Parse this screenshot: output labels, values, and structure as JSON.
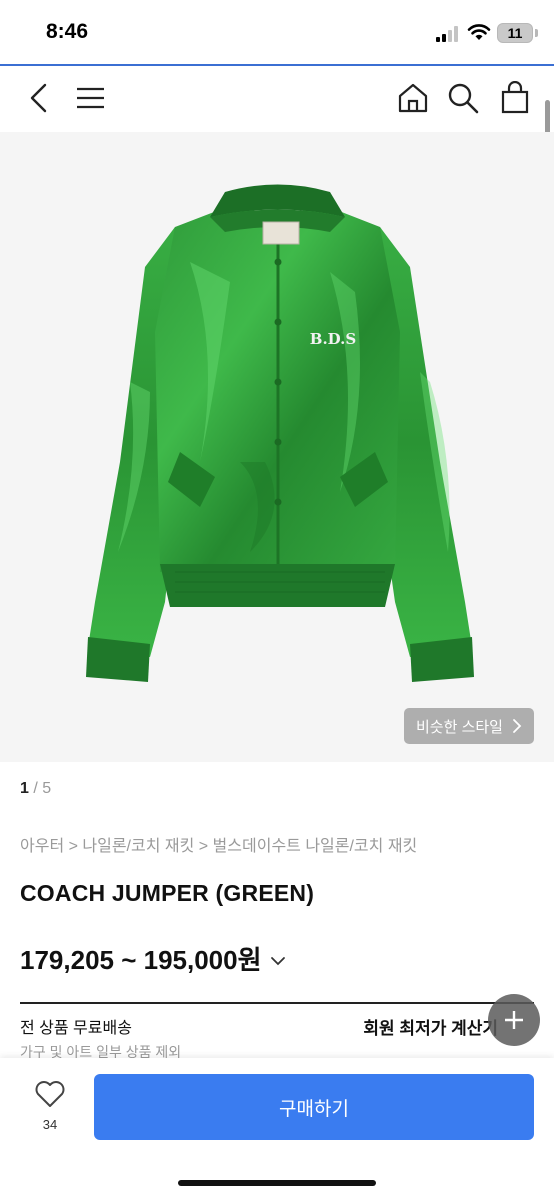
{
  "status_bar": {
    "time": "8:46",
    "battery_level": "11"
  },
  "header": {
    "back_icon": "chevron-left-icon",
    "menu_icon": "hamburger-menu-icon",
    "home_icon": "home-icon",
    "search_icon": "search-icon",
    "cart_icon": "shopping-bag-icon"
  },
  "product": {
    "image_alt": "green satin jacket",
    "logo_text": "B.D.S",
    "similar_style_label": "비슷한 스타일",
    "image_index": "1",
    "image_total": "/ 5",
    "breadcrumb": "아우터 > 나일론/코치 재킷 > 벌스데이수트 나일론/코치 재킷",
    "title": "COACH JUMPER (GREEN)",
    "price_range": "179,205 ~ 195,000원"
  },
  "shipping": {
    "main": "전 상품 무료배송",
    "sub": "가구 및 아트 일부 상품 제외",
    "member_price_label": "회원 최저가 계산기"
  },
  "bottom_bar": {
    "wishlist_count": "34",
    "buy_label": "구매하기"
  },
  "colors": {
    "accent": "#3a7cf0",
    "jacket_green": "#2f9a3a",
    "header_line": "#3b6fd3"
  }
}
